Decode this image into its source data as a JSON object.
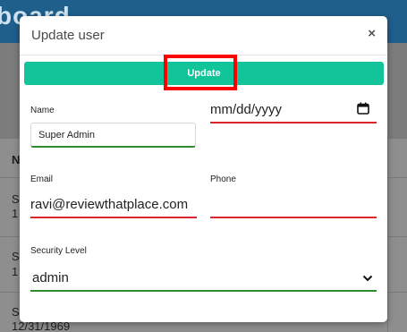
{
  "background": {
    "title_fragment": "board",
    "table_header": "N",
    "rows": [
      {
        "line1": "S",
        "line2": "1"
      },
      {
        "line1": "S",
        "line2": "1"
      },
      {
        "line1": "S",
        "line2": "12/31/1969"
      }
    ]
  },
  "modal": {
    "title": "Update user",
    "close_glyph": "×",
    "update_label": "Update",
    "name": {
      "label": "Name",
      "value": "Super Admin"
    },
    "date": {
      "placeholder": "mm/dd/yyyy"
    },
    "email": {
      "label": "Email",
      "value": "ravi@reviewthatplace.com"
    },
    "phone": {
      "label": "Phone",
      "value": ""
    },
    "security_level": {
      "label": "Security Level",
      "selected": "admin"
    }
  },
  "icons": {
    "calendar": "calendar-icon",
    "chevron": "chevron-down-icon",
    "close": "close-icon"
  },
  "colors": {
    "accent": "#12c49a",
    "highlight": "#ff0000",
    "valid_underline": "#2e8b2e",
    "invalid_underline": "#d9262c",
    "header": "#1f5f8b"
  }
}
